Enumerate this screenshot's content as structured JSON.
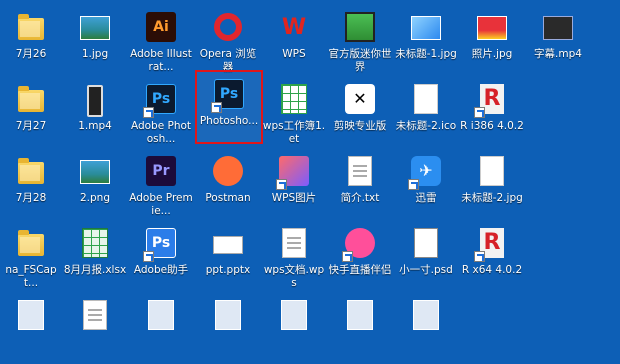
{
  "desktop": {
    "background_color": "#0d5fb6",
    "selection_color": "#e0161a",
    "icons": [
      {
        "label": "7月26",
        "icon": "folder-icon"
      },
      {
        "label": "1.jpg",
        "icon": "image-icon"
      },
      {
        "label": "Adobe Illustrat...",
        "icon": "illustrator-icon"
      },
      {
        "label": "Opera 浏览器",
        "icon": "opera-icon"
      },
      {
        "label": "WPS",
        "icon": "wps-icon"
      },
      {
        "label": "官方版迷你世界",
        "icon": "game-icon"
      },
      {
        "label": "未标题-1.jpg",
        "icon": "image-icon"
      },
      {
        "label": "照片.jpg",
        "icon": "photo-icon"
      },
      {
        "label": "字幕.mp4",
        "icon": "video-icon"
      },
      {
        "label": "7月27",
        "icon": "folder-icon"
      },
      {
        "label": "1.mp4",
        "icon": "video-icon"
      },
      {
        "label": "Adobe Photosh...",
        "icon": "photoshop-icon"
      },
      {
        "label": "Photosho...",
        "icon": "photoshop-icon"
      },
      {
        "label": "wps工作簿1.et",
        "icon": "spreadsheet-icon"
      },
      {
        "label": "剪映专业版",
        "icon": "capcut-icon"
      },
      {
        "label": "未标题-2.ico",
        "icon": "ico-file-icon"
      },
      {
        "label": "R i386 4.0.2",
        "icon": "r-icon"
      },
      {
        "label": "7月28",
        "icon": "folder-icon"
      },
      {
        "label": "2.png",
        "icon": "image-icon"
      },
      {
        "label": "Adobe Premie...",
        "icon": "premiere-icon"
      },
      {
        "label": "Postman",
        "icon": "postman-icon"
      },
      {
        "label": "WPS图片",
        "icon": "wps-picture-icon"
      },
      {
        "label": "简介.txt",
        "icon": "text-file-icon"
      },
      {
        "label": "迅雷",
        "icon": "thunder-icon"
      },
      {
        "label": "未标题-2.jpg",
        "icon": "image-icon"
      },
      {
        "label": "na_FSCapt...",
        "icon": "folder-icon"
      },
      {
        "label": "8月月报.xlsx",
        "icon": "excel-icon"
      },
      {
        "label": "Adobe助手",
        "icon": "photoshop-icon"
      },
      {
        "label": "ppt.pptx",
        "icon": "ppt-icon"
      },
      {
        "label": "wps文档.wps",
        "icon": "wps-doc-icon"
      },
      {
        "label": "快手直播伴侣",
        "icon": "kuaishou-icon"
      },
      {
        "label": "小一寸.psd",
        "icon": "psd-file-icon"
      },
      {
        "label": "R x64 4.0.2",
        "icon": "r-icon"
      }
    ]
  }
}
